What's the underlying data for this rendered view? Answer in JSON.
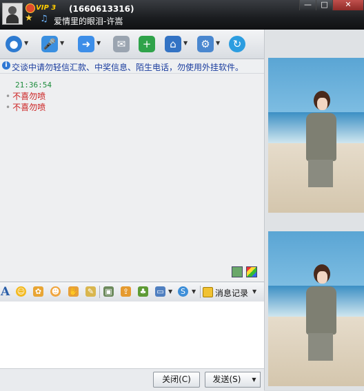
{
  "titlebar": {
    "vip_label": "VIP 3",
    "qq_number": "(1660613316)",
    "signature": "爱情里的眼泪-许嵩",
    "buttons": [
      "minimize-icon",
      "maximize-icon",
      "close-icon"
    ],
    "minimize_glyph": "—",
    "maximize_glyph": "□",
    "close_glyph": "✕"
  },
  "toolbar": {
    "icons": [
      "webcam-icon",
      "microphone-icon",
      "folder-send-icon",
      "message-icon",
      "add-chat-icon",
      "remote-assist-icon",
      "settings-icon",
      "refresh-icon"
    ]
  },
  "notice": {
    "text": "交谈中请勿轻信汇款、中奖信息、陌生电话，勿使用外挂软件。"
  },
  "chat": {
    "time": "21:36:54",
    "messages": [
      "不喜勿喷",
      "不喜勿喷"
    ]
  },
  "input_toolbar": {
    "icons": [
      "font-icon",
      "emoji-icon",
      "gif-icon",
      "cartoon-icon",
      "thumb-icon",
      "edit-icon",
      "image-icon",
      "send-file-icon",
      "game-icon",
      "screenshot-icon",
      "music-share-icon",
      "history-icon"
    ],
    "history_label": "消息记录"
  },
  "buttons": {
    "close": "关闭(C)",
    "send": "发送(S)"
  },
  "colors": {
    "titlebar": "#1b1d20",
    "notice_text": "#1a3c9e",
    "message_text": "#cc1f1f",
    "time_text": "#1d8c3c"
  }
}
